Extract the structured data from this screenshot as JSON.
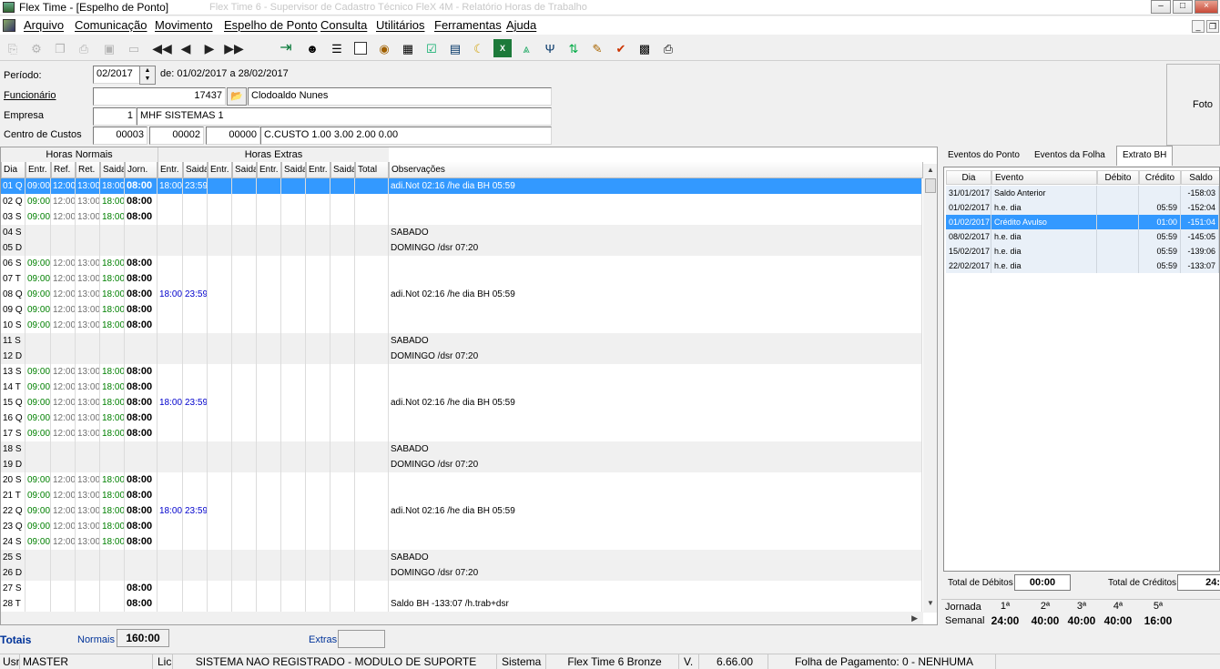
{
  "window": {
    "title": "Flex Time - [Espelho de Ponto]",
    "ghost_title": "Flex Time 6 - Supervisor de Cadastro Técnico    FleX 4M - Relatório Horas de Trabalho",
    "min": "–",
    "max": "□",
    "close": "×"
  },
  "menu": [
    "Arquivo",
    "Comunicação",
    "Movimento",
    "Espelho de Ponto",
    "Consulta",
    "Utilitários",
    "Ferramentas",
    "Ajuda"
  ],
  "mdi": {
    "min": "_",
    "restore": "❐"
  },
  "toolbar_icons": [
    "new-icon",
    "config-icon",
    "copy-icon",
    "print-icon",
    "save-icon",
    "document-icon",
    "first-icon",
    "prev-icon",
    "next-icon",
    "last-icon",
    "exit-icon",
    "person-icon",
    "list-icon",
    "grid-icon",
    "coins-icon",
    "table-icon",
    "check-icon",
    "calendar-icon",
    "moon-icon",
    "excel-icon",
    "badge-icon",
    "fork-icon",
    "transfer-icon",
    "edit-icon",
    "chart-icon",
    "calculator-icon",
    "printer-icon"
  ],
  "form": {
    "periodo_label": "Período:",
    "periodo_value": "02/2017",
    "periodo_range": "de: 01/02/2017 a 28/02/2017",
    "funcionario_label": "Funcionário",
    "funcionario_id": "17437",
    "funcionario_nome": "Clodoaldo Nunes",
    "empresa_label": "Empresa",
    "empresa_id": "1",
    "empresa_nome": "MHF SISTEMAS 1",
    "cc_label": "Centro de Custos",
    "cc_1": "00003",
    "cc_2": "00002",
    "cc_3": "00000",
    "cc_desc": "C.CUSTO 1.00  3.00  2.00  0.00",
    "foto_label": "Foto"
  },
  "grid": {
    "group_normais": "Horas Normais",
    "group_extras": "Horas Extras",
    "headers": [
      "Dia",
      "Entr.",
      "Ref.",
      "Ret.",
      "Saida",
      "Jorn.",
      "Entr.",
      "Saida",
      "Entr.",
      "Saida",
      "Entr.",
      "Saida",
      "Entr.",
      "Saida",
      "Total",
      "Observações"
    ],
    "rows": [
      {
        "dia": "01 Q",
        "e": "09:00",
        "r": "12:00",
        "t": "13:00",
        "s": "18:00",
        "j": "08:00",
        "xe": "18:00",
        "xs": "23:59",
        "obs": "adi.Not 02:16 /he dia BH 05:59",
        "sel": true
      },
      {
        "dia": "02 Q",
        "e": "09:00",
        "r": "12:00",
        "t": "13:00",
        "s": "18:00",
        "j": "08:00",
        "xe": "",
        "xs": "",
        "obs": ""
      },
      {
        "dia": "03 S",
        "e": "09:00",
        "r": "12:00",
        "t": "13:00",
        "s": "18:00",
        "j": "08:00",
        "xe": "",
        "xs": "",
        "obs": ""
      },
      {
        "dia": "04 S",
        "e": "",
        "r": "",
        "t": "",
        "s": "",
        "j": "",
        "xe": "",
        "xs": "",
        "obs": "SABADO",
        "alt": true
      },
      {
        "dia": "05 D",
        "e": "",
        "r": "",
        "t": "",
        "s": "",
        "j": "",
        "xe": "",
        "xs": "",
        "obs": "DOMINGO /dsr      07:20",
        "alt": true
      },
      {
        "dia": "06 S",
        "e": "09:00",
        "r": "12:00",
        "t": "13:00",
        "s": "18:00",
        "j": "08:00",
        "xe": "",
        "xs": "",
        "obs": ""
      },
      {
        "dia": "07 T",
        "e": "09:00",
        "r": "12:00",
        "t": "13:00",
        "s": "18:00",
        "j": "08:00",
        "xe": "",
        "xs": "",
        "obs": ""
      },
      {
        "dia": "08 Q",
        "e": "09:00",
        "r": "12:00",
        "t": "13:00",
        "s": "18:00",
        "j": "08:00",
        "xe": "18:00",
        "xs": "23:59",
        "obs": "adi.Not 02:16 /he dia BH 05:59"
      },
      {
        "dia": "09 Q",
        "e": "09:00",
        "r": "12:00",
        "t": "13:00",
        "s": "18:00",
        "j": "08:00",
        "xe": "",
        "xs": "",
        "obs": ""
      },
      {
        "dia": "10 S",
        "e": "09:00",
        "r": "12:00",
        "t": "13:00",
        "s": "18:00",
        "j": "08:00",
        "xe": "",
        "xs": "",
        "obs": ""
      },
      {
        "dia": "11 S",
        "e": "",
        "r": "",
        "t": "",
        "s": "",
        "j": "",
        "xe": "",
        "xs": "",
        "obs": "SABADO",
        "alt": true
      },
      {
        "dia": "12 D",
        "e": "",
        "r": "",
        "t": "",
        "s": "",
        "j": "",
        "xe": "",
        "xs": "",
        "obs": "DOMINGO /dsr      07:20",
        "alt": true
      },
      {
        "dia": "13 S",
        "e": "09:00",
        "r": "12:00",
        "t": "13:00",
        "s": "18:00",
        "j": "08:00",
        "xe": "",
        "xs": "",
        "obs": ""
      },
      {
        "dia": "14 T",
        "e": "09:00",
        "r": "12:00",
        "t": "13:00",
        "s": "18:00",
        "j": "08:00",
        "xe": "",
        "xs": "",
        "obs": ""
      },
      {
        "dia": "15 Q",
        "e": "09:00",
        "r": "12:00",
        "t": "13:00",
        "s": "18:00",
        "j": "08:00",
        "xe": "18:00",
        "xs": "23:59",
        "obs": "adi.Not 02:16 /he dia BH 05:59"
      },
      {
        "dia": "16 Q",
        "e": "09:00",
        "r": "12:00",
        "t": "13:00",
        "s": "18:00",
        "j": "08:00",
        "xe": "",
        "xs": "",
        "obs": ""
      },
      {
        "dia": "17 S",
        "e": "09:00",
        "r": "12:00",
        "t": "13:00",
        "s": "18:00",
        "j": "08:00",
        "xe": "",
        "xs": "",
        "obs": ""
      },
      {
        "dia": "18 S",
        "e": "",
        "r": "",
        "t": "",
        "s": "",
        "j": "",
        "xe": "",
        "xs": "",
        "obs": "SABADO",
        "alt": true
      },
      {
        "dia": "19 D",
        "e": "",
        "r": "",
        "t": "",
        "s": "",
        "j": "",
        "xe": "",
        "xs": "",
        "obs": "DOMINGO /dsr      07:20",
        "alt": true
      },
      {
        "dia": "20 S",
        "e": "09:00",
        "r": "12:00",
        "t": "13:00",
        "s": "18:00",
        "j": "08:00",
        "xe": "",
        "xs": "",
        "obs": ""
      },
      {
        "dia": "21 T",
        "e": "09:00",
        "r": "12:00",
        "t": "13:00",
        "s": "18:00",
        "j": "08:00",
        "xe": "",
        "xs": "",
        "obs": ""
      },
      {
        "dia": "22 Q",
        "e": "09:00",
        "r": "12:00",
        "t": "13:00",
        "s": "18:00",
        "j": "08:00",
        "xe": "18:00",
        "xs": "23:59",
        "obs": "adi.Not 02:16 /he dia BH 05:59"
      },
      {
        "dia": "23 Q",
        "e": "09:00",
        "r": "12:00",
        "t": "13:00",
        "s": "18:00",
        "j": "08:00",
        "xe": "",
        "xs": "",
        "obs": ""
      },
      {
        "dia": "24 S",
        "e": "09:00",
        "r": "12:00",
        "t": "13:00",
        "s": "18:00",
        "j": "08:00",
        "xe": "",
        "xs": "",
        "obs": ""
      },
      {
        "dia": "25 S",
        "e": "",
        "r": "",
        "t": "",
        "s": "",
        "j": "",
        "xe": "",
        "xs": "",
        "obs": "SABADO",
        "alt": true
      },
      {
        "dia": "26 D",
        "e": "",
        "r": "",
        "t": "",
        "s": "",
        "j": "",
        "xe": "",
        "xs": "",
        "obs": "DOMINGO /dsr      07:20",
        "alt": true
      },
      {
        "dia": "27 S",
        "e": "",
        "r": "",
        "t": "",
        "s": "",
        "j": "08:00",
        "xe": "",
        "xs": "",
        "obs": ""
      },
      {
        "dia": "28 T",
        "e": "",
        "r": "",
        "t": "",
        "s": "",
        "j": "08:00",
        "xe": "",
        "xs": "",
        "obs": "Saldo BH -133:07 /h.trab+dsr"
      }
    ]
  },
  "tabs": [
    "Eventos do Ponto",
    "Eventos da Folha",
    "Extrato BH"
  ],
  "extrato": {
    "headers": [
      "Dia",
      "Evento",
      "Débito",
      "Crédito",
      "Saldo"
    ],
    "rows": [
      {
        "dia": "31/01/2017",
        "evento": "Saldo Anterior",
        "debito": "",
        "credito": "",
        "saldo": "-158:03"
      },
      {
        "dia": "01/02/2017",
        "evento": "h.e. dia",
        "debito": "",
        "credito": "05:59",
        "saldo": "-152:04"
      },
      {
        "dia": "01/02/2017",
        "evento": "Crédito Avulso",
        "debito": "",
        "credito": "01:00",
        "saldo": "-151:04",
        "sel": true
      },
      {
        "dia": "08/02/2017",
        "evento": "h.e. dia",
        "debito": "",
        "credito": "05:59",
        "saldo": "-145:05"
      },
      {
        "dia": "15/02/2017",
        "evento": "h.e. dia",
        "debito": "",
        "credito": "05:59",
        "saldo": "-139:06"
      },
      {
        "dia": "22/02/2017",
        "evento": "h.e. dia",
        "debito": "",
        "credito": "05:59",
        "saldo": "-133:07"
      }
    ],
    "total_debitos_label": "Total de Débitos",
    "total_debitos": "00:00",
    "total_creditos_label": "Total de Créditos",
    "total_creditos": "24:"
  },
  "jornada": {
    "label_jornada": "Jornada",
    "label_semanal": "Semanal",
    "weeks": [
      "1ª",
      "2ª",
      "3ª",
      "4ª",
      "5ª"
    ],
    "values": [
      "24:00",
      "40:00",
      "40:00",
      "40:00",
      "16:00"
    ]
  },
  "totals": {
    "label": "Totais",
    "normais_label": "Normais",
    "normais_value": "160:00",
    "extras_label": "Extras",
    "extras_value": ""
  },
  "status": {
    "usr_label": "Usr",
    "usr_value": "MASTER",
    "lic_label": "Lic",
    "lic_value": "SISTEMA NAO REGISTRADO - MODULO DE SUPORTE",
    "sistema_label": "Sistema",
    "sistema_value": "Flex Time 6 Bronze",
    "v_label": "V.",
    "v_value": "6.66.00",
    "folha": "Folha de Pagamento: 0 - NENHUMA"
  }
}
